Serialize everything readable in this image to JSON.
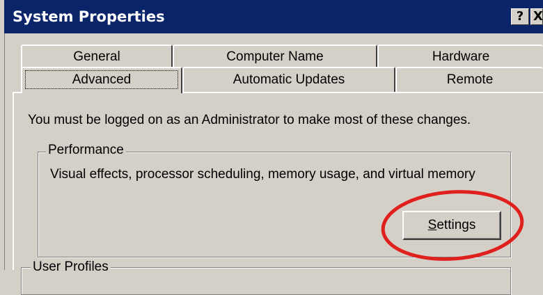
{
  "window": {
    "title": "System Properties",
    "help_glyph": "?",
    "close_glyph": "X"
  },
  "tabs": {
    "row1": [
      {
        "label": "General"
      },
      {
        "label": "Computer Name"
      },
      {
        "label": "Hardware"
      }
    ],
    "row2": [
      {
        "label": "Advanced",
        "selected": true
      },
      {
        "label": "Automatic Updates"
      },
      {
        "label": "Remote"
      }
    ]
  },
  "advanced": {
    "admin_note": "You must be logged on as an Administrator to make most of these changes.",
    "performance": {
      "group_label": "Performance",
      "description": "Visual effects, processor scheduling, memory usage, and virtual memory",
      "settings_mnemonic": "S",
      "settings_rest": "ettings"
    },
    "user_profiles": {
      "group_label": "User Profiles"
    }
  },
  "colors": {
    "titlebar": "#0a246a",
    "face": "#d4d0c8",
    "annotation": "#e0201c"
  }
}
